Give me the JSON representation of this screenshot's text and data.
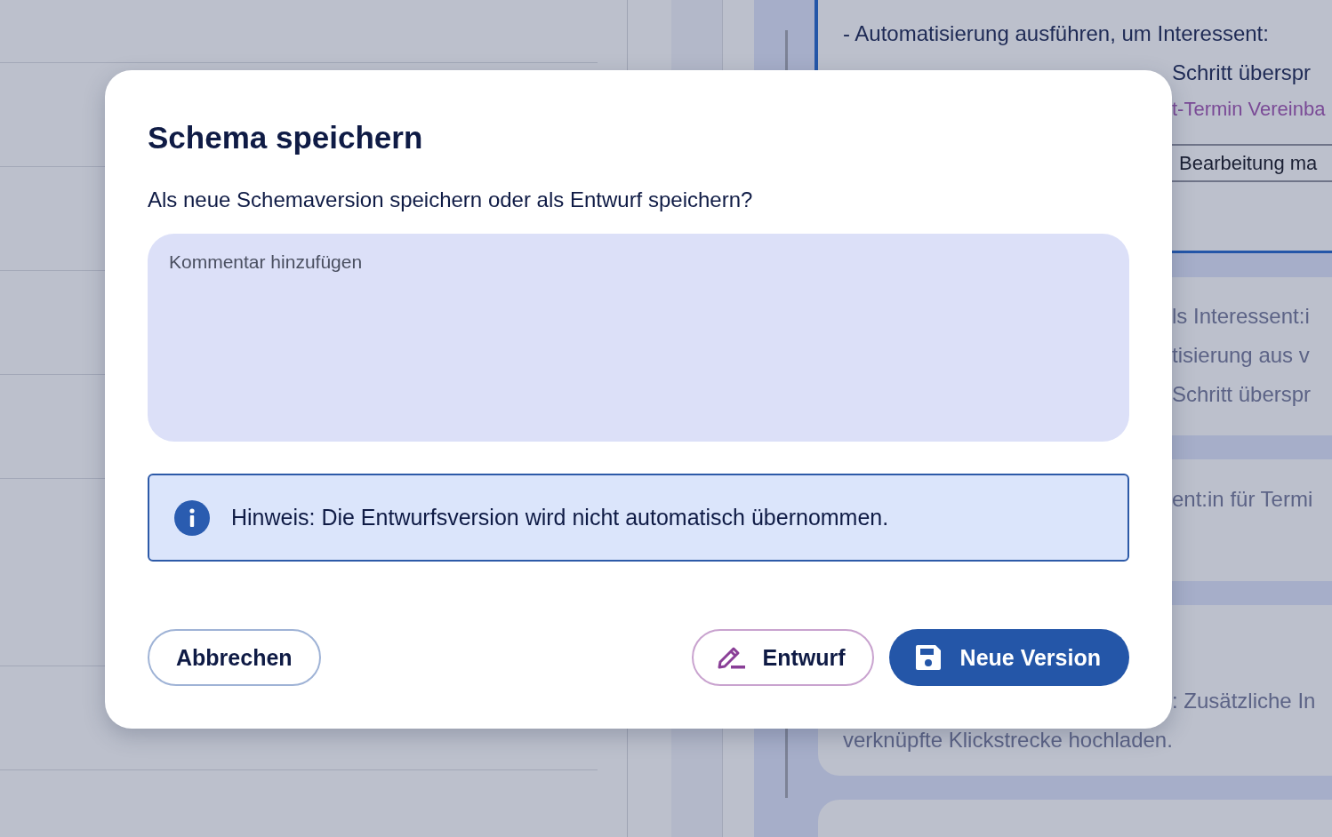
{
  "background": {
    "cards": [
      {
        "lines": [
          {
            "text": "- Automatisierung ausführen, um Interessent:",
            "kind": "text",
            "covered": false
          },
          {
            "text": "Schritt überspr",
            "kind": "text",
            "covered": true
          },
          {
            "text": "t-Termin Vereinba",
            "kind": "link",
            "covered": true
          }
        ],
        "footer": "Bearbeitung ma",
        "active": true
      },
      {
        "lines": [
          {
            "text": "ls Interessent:i",
            "kind": "text",
            "covered": true
          },
          {
            "text": "tisierung aus v",
            "kind": "text",
            "covered": true
          },
          {
            "text": "Schritt überspr",
            "kind": "text",
            "covered": true
          }
        ],
        "active": false
      },
      {
        "lines": [
          {
            "text": "ent:in für Termi",
            "kind": "text",
            "covered": true
          }
        ],
        "active": false
      },
      {
        "lines": [
          {
            "text": ": Zusätzliche In",
            "kind": "text",
            "covered": true
          },
          {
            "text": "verknüpfte Klickstrecke hochladen.",
            "kind": "text",
            "covered": false
          }
        ],
        "active": false
      },
      {
        "active": false
      }
    ]
  },
  "dialog": {
    "title": "Schema speichern",
    "message": "Als neue Schemaversion speichern oder als Entwurf speichern?",
    "comment": {
      "placeholder": "Kommentar hinzufügen"
    },
    "notice": "Hinweis: Die Entwurfsversion wird nicht automatisch übernommen.",
    "buttons": [
      {
        "label": "Abbrechen",
        "kind": "outline"
      },
      {
        "label": "Entwurf",
        "kind": "draft"
      },
      {
        "label": "Neue Version",
        "kind": "primary"
      }
    ]
  }
}
